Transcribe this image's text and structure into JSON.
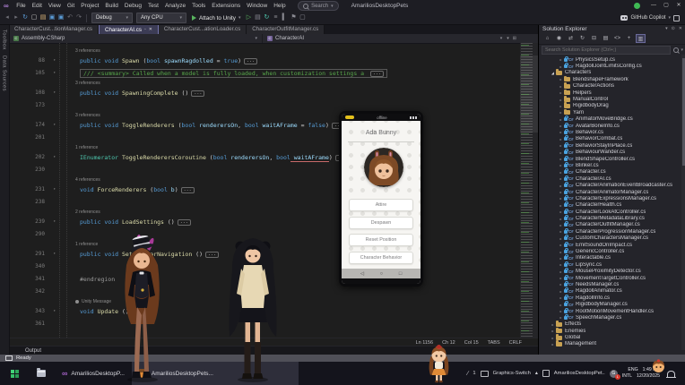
{
  "window": {
    "app_icon": "∞",
    "menus": [
      "File",
      "Edit",
      "View",
      "Git",
      "Project",
      "Build",
      "Debug",
      "Test",
      "Analyze",
      "Tools",
      "Extensions",
      "Window",
      "Help"
    ],
    "search_label": "Search",
    "solution_title": "AmariliosDesktopPets",
    "copilot_label": "GitHub Copilot",
    "controls": {
      "minimize": "—",
      "maximize": "▢",
      "close": "✕"
    }
  },
  "toolbar": {
    "icons_left": [
      {
        "n": "nav-backward-icon",
        "g": "◂",
        "c": "#6f6f76"
      },
      {
        "n": "nav-forward-icon",
        "g": "▸",
        "c": "#6f6f76"
      },
      {
        "n": "hot-reload-icon",
        "g": "↻",
        "c": "#5b9bd5"
      },
      {
        "n": "new-file-icon",
        "g": "▢",
        "c": "#c8c8c8"
      },
      {
        "n": "open-file-icon",
        "g": "▤",
        "c": "#dcb67a"
      },
      {
        "n": "save-icon",
        "g": "▣",
        "c": "#5b9bd5"
      },
      {
        "n": "save-all-icon",
        "g": "▣",
        "c": "#5b9bd5"
      },
      {
        "n": "undo-icon",
        "g": "↶",
        "c": "#6f6f76"
      },
      {
        "n": "redo-icon",
        "g": "↷",
        "c": "#6f6f76"
      }
    ],
    "config_value": "Debug",
    "platform_value": "Any CPU",
    "run_label": "Attach to Unity",
    "icons_right": [
      {
        "n": "start-without-debugging-icon",
        "g": "▷",
        "c": "#58b35e"
      },
      {
        "n": "break-all-icon",
        "g": "▤",
        "c": "#8a8a92"
      },
      {
        "n": "restart-icon",
        "g": "↻",
        "c": "#4ec9b0"
      },
      {
        "n": "document-outline-icon",
        "g": "≡",
        "c": "#8a8a92"
      },
      {
        "n": "indent-guides-icon",
        "g": "▍",
        "c": "#8a8a92"
      },
      {
        "n": "bookmark-icon",
        "g": "⚑",
        "c": "#8a8a92"
      },
      {
        "n": "toolbox-options-icon",
        "g": "▢",
        "c": "#8a8a92"
      }
    ]
  },
  "side_tabs": [
    "Toolbox",
    "Data Sources"
  ],
  "tabs": [
    {
      "label": "CharacterCust...tionManager.cs",
      "active": false
    },
    {
      "label": "CharacterAI.cs",
      "active": true
    },
    {
      "label": "CharacterCust...ationLoader.cs",
      "active": false
    },
    {
      "label": "CharacterOutfitManager.cs",
      "active": false
    }
  ],
  "navbar": {
    "project": "Assembly-CSharp",
    "type_name": "CharacterAI"
  },
  "editor": {
    "lines": [
      {
        "n": "88",
        "lens": "3 references",
        "seg": [
          [
            "k",
            "public void "
          ],
          [
            "m",
            "Spawn"
          ],
          [
            "d",
            " ("
          ],
          [
            "k",
            "bool"
          ],
          [
            "p",
            " spawnRagdolled"
          ],
          [
            "d",
            " = "
          ],
          [
            "k",
            "true"
          ],
          [
            "d",
            ")"
          ]
        ],
        "ell": true
      },
      {
        "n": "105",
        "boxed": true,
        "seg": [
          [
            "c",
            "/// <summary> Called when a model is fully loaded, when customization settings a "
          ]
        ],
        "ell": true
      },
      {
        "n": "108",
        "lens": "3 references",
        "seg": [
          [
            "k",
            "public void "
          ],
          [
            "m",
            "SpawningComplete"
          ],
          [
            "d",
            " ()"
          ]
        ],
        "ell": true
      },
      {
        "n": "173",
        "blank": true
      },
      {
        "n": "174",
        "lens": "3 references",
        "seg": [
          [
            "k",
            "public void "
          ],
          [
            "m",
            "ToggleRenderers"
          ],
          [
            "d",
            " ("
          ],
          [
            "k",
            "bool"
          ],
          [
            "p",
            " renderersOn"
          ],
          [
            "d",
            ", "
          ],
          [
            "k",
            "bool"
          ],
          [
            "p",
            " waitAFrame"
          ],
          [
            "d",
            " = "
          ],
          [
            "k",
            "false"
          ],
          [
            "d",
            ")"
          ]
        ],
        "ell": true
      },
      {
        "n": "201",
        "blank": true
      },
      {
        "n": "202",
        "lens": "1 reference",
        "seg": [
          [
            "t",
            "IEnumerator "
          ],
          [
            "m",
            "ToggleRenderersCoroutine"
          ],
          [
            "d",
            " ("
          ],
          [
            "k",
            "bool"
          ],
          [
            "p",
            " renderersOn"
          ],
          [
            "d",
            ", "
          ],
          [
            "k",
            "bool"
          ],
          [
            "pu",
            " waitAFrame"
          ],
          [
            "d",
            ")"
          ]
        ],
        "ell": true
      },
      {
        "n": "230",
        "blank": true
      },
      {
        "n": "231",
        "lens": "4 references",
        "seg": [
          [
            "k",
            "void "
          ],
          [
            "m",
            "ForceRenderers"
          ],
          [
            "d",
            " ("
          ],
          [
            "k",
            "bool"
          ],
          [
            "p",
            " b"
          ],
          [
            "d",
            ")"
          ]
        ],
        "ell": true
      },
      {
        "n": "238",
        "blank": true
      },
      {
        "n": "239",
        "lens": "2 references",
        "seg": [
          [
            "k",
            "public void "
          ],
          [
            "m",
            "LoadSettings"
          ],
          [
            "d",
            " ()"
          ]
        ],
        "ell": true
      },
      {
        "n": "290",
        "blank": true
      },
      {
        "n": "291",
        "lens": "1 reference",
        "seg": [
          [
            "k",
            "public void "
          ],
          [
            "m",
            "SetupAStarNavigation"
          ],
          [
            "d",
            " ()"
          ]
        ],
        "ell": true
      },
      {
        "n": "340",
        "blank": true
      },
      {
        "n": "341",
        "noarrow": true,
        "seg": [
          [
            "g",
            "#endregion"
          ]
        ],
        "ell": false
      },
      {
        "n": "342",
        "blank": true
      },
      {
        "n": "343",
        "lens": "Unity Message",
        "unity": true,
        "seg": [
          [
            "k",
            "void "
          ],
          [
            "m",
            "Update"
          ],
          [
            "d",
            " ()"
          ]
        ],
        "ell": false
      },
      {
        "n": "361",
        "blank": true
      }
    ],
    "status_items": [
      "Ln 1156",
      "Ch 12",
      "Col 15",
      "TABS",
      "CRLF"
    ],
    "output_tab": "Output"
  },
  "status_bar": {
    "text": "Ready"
  },
  "phone": {
    "status_center": "offline",
    "name": "Ada Bunny",
    "buttons": [
      "Attire",
      "Despawn",
      "Reset Position",
      "Character Behavior"
    ]
  },
  "solution_explorer": {
    "title": "Solution Explorer",
    "search_placeholder": "Search Solution Explorer (Ctrl+;)",
    "toolbar_icons": [
      {
        "n": "home-icon",
        "g": "⌂",
        "hl": false
      },
      {
        "n": "pending-changes-icon",
        "g": "◉",
        "hl": false
      },
      {
        "n": "sync-namespaces-icon",
        "g": "⇄",
        "hl": false
      },
      {
        "n": "refresh-icon",
        "g": "↻",
        "hl": false
      },
      {
        "n": "collapse-all-icon",
        "g": "⊟",
        "hl": false
      },
      {
        "n": "show-all-files-icon",
        "g": "▤",
        "hl": false
      },
      {
        "n": "view-code-icon",
        "g": "<>",
        "hl": false
      },
      {
        "n": "add-item-icon",
        "g": "+",
        "hl": false
      },
      {
        "n": "sync-with-active-document-icon",
        "g": "▥",
        "hl": true
      }
    ],
    "items": [
      {
        "k": "file",
        "d": 3,
        "n": "PhysicsSetup.cs"
      },
      {
        "k": "file",
        "d": 3,
        "n": "RagdollJointLimitsConfig.cs"
      },
      {
        "k": "folder-open",
        "d": 2,
        "n": "Characters"
      },
      {
        "k": "folder",
        "d": 3,
        "n": "BlendshapeFramework"
      },
      {
        "k": "folder",
        "d": 3,
        "n": "CharacterActions"
      },
      {
        "k": "folder",
        "d": 3,
        "n": "Helpers"
      },
      {
        "k": "folder",
        "d": 3,
        "n": "ManualControl"
      },
      {
        "k": "folder",
        "d": 3,
        "n": "RigidbodyDrag"
      },
      {
        "k": "folder",
        "d": 3,
        "n": "Yarn"
      },
      {
        "k": "file",
        "d": 3,
        "n": "AnimatorMoveBridge.cs"
      },
      {
        "k": "file",
        "d": 3,
        "n": "AvatarBoneInfo.cs"
      },
      {
        "k": "file",
        "d": 3,
        "n": "Behavior.cs"
      },
      {
        "k": "file",
        "d": 3,
        "n": "BehaviorCombat.cs"
      },
      {
        "k": "file",
        "d": 3,
        "n": "BehaviorStayInPlace.cs"
      },
      {
        "k": "file",
        "d": 3,
        "n": "BehaviourWander.cs"
      },
      {
        "k": "file",
        "d": 3,
        "n": "BlendShapeController.cs"
      },
      {
        "k": "file",
        "d": 3,
        "n": "Blinker.cs"
      },
      {
        "k": "file",
        "d": 3,
        "n": "Character.cs"
      },
      {
        "k": "file",
        "d": 3,
        "n": "CharacterAI.cs"
      },
      {
        "k": "file",
        "d": 3,
        "n": "CharacterAnimationEventBroadcaster.cs"
      },
      {
        "k": "file",
        "d": 3,
        "n": "CharacterAnimatorManager.cs"
      },
      {
        "k": "file",
        "d": 3,
        "n": "CharacterExpressionsManager.cs"
      },
      {
        "k": "file",
        "d": 3,
        "n": "CharacterHealth.cs"
      },
      {
        "k": "file",
        "d": 3,
        "n": "CharacterLookAtController.cs"
      },
      {
        "k": "file",
        "d": 3,
        "n": "CharacterMetadataLibrary.cs"
      },
      {
        "k": "file",
        "d": 3,
        "n": "CharacterOutfitManager.cs"
      },
      {
        "k": "file",
        "d": 3,
        "n": "CharacterProgressionManager.cs"
      },
      {
        "k": "file",
        "d": 3,
        "n": "CustomCharactersManager.cs"
      },
      {
        "k": "file",
        "d": 3,
        "n": "EmitSoundOnImpact.cs"
      },
      {
        "k": "file",
        "d": 3,
        "n": "GenericController.cs"
      },
      {
        "k": "file",
        "d": 3,
        "n": "Interactable.cs"
      },
      {
        "k": "file",
        "d": 3,
        "n": "LipSync.cs"
      },
      {
        "k": "file",
        "d": 3,
        "n": "MouseProximityDetector.cs"
      },
      {
        "k": "file",
        "d": 3,
        "n": "MovementTargetController.cs"
      },
      {
        "k": "file",
        "d": 3,
        "n": "NeedsManager.cs"
      },
      {
        "k": "file",
        "d": 3,
        "n": "RagdollAnimator.cs"
      },
      {
        "k": "file",
        "d": 3,
        "n": "RagdollInfo.cs"
      },
      {
        "k": "file",
        "d": 3,
        "n": "RigidbodyManager.cs"
      },
      {
        "k": "file",
        "d": 3,
        "n": "RootMotionMovementHandler.cs"
      },
      {
        "k": "file",
        "d": 3,
        "n": "SpeechManager.cs"
      },
      {
        "k": "folder",
        "d": 2,
        "n": "Effects"
      },
      {
        "k": "folder",
        "d": 2,
        "n": "Enemies"
      },
      {
        "k": "folder",
        "d": 2,
        "n": "Global"
      },
      {
        "k": "folder",
        "d": 2,
        "n": "Management"
      }
    ]
  },
  "taskbar": {
    "vs_window_label": "AmariliosDesktopP...",
    "app_window_label": "AmariliosDesktopPets...",
    "annotate_count": "1",
    "graphics_switch_label": "Graphics-Switch",
    "tray_arrow": "▴",
    "tray_app_label": "AmariliosDesktopPet..",
    "badge_letter": "G",
    "badge_count": "1",
    "lang_line1": "ENG",
    "lang_line2": "INTL",
    "time": "1:49 PM",
    "date": "12/20/2025"
  }
}
